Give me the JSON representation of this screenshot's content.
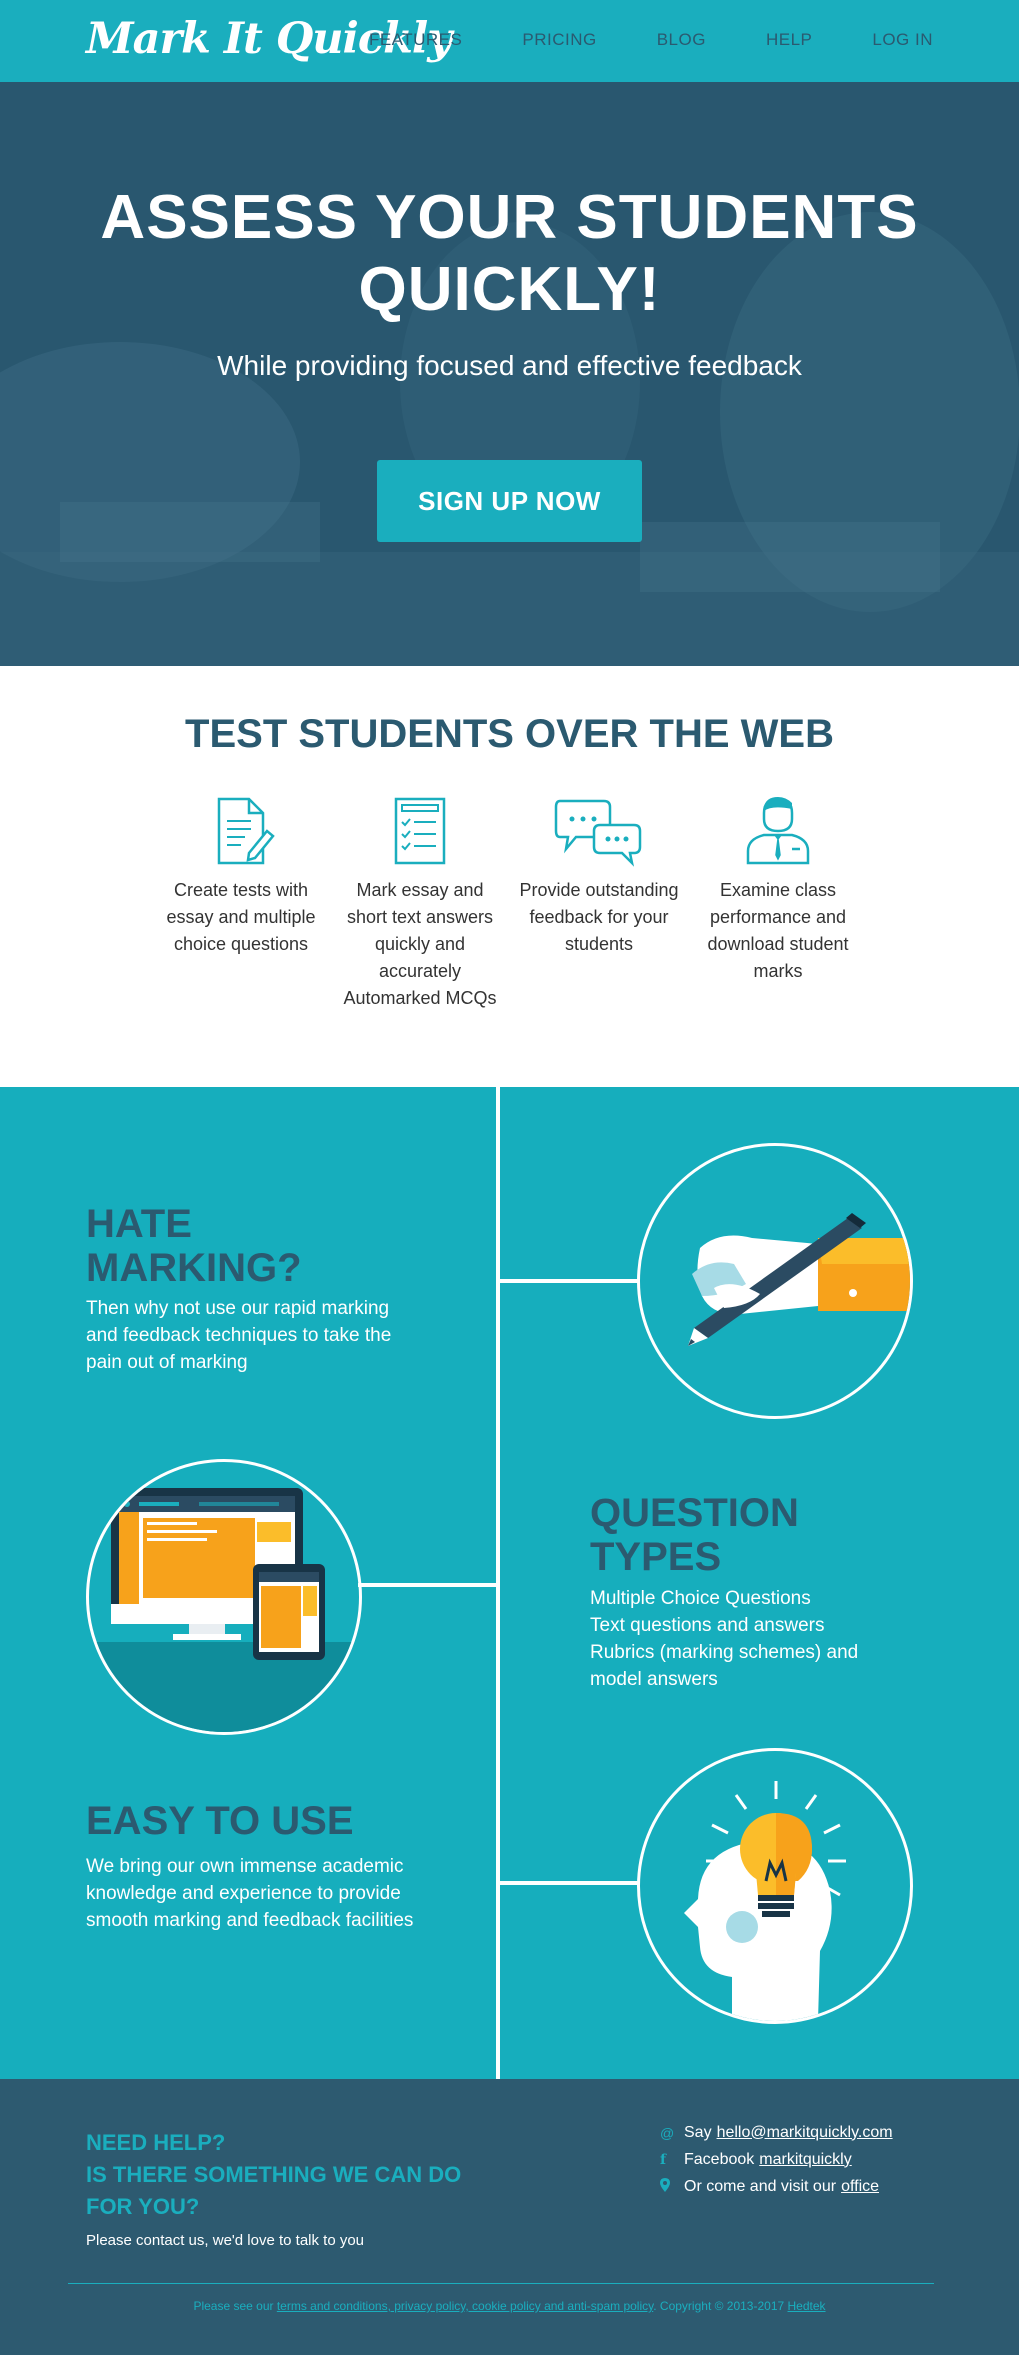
{
  "nav": {
    "logo": "Mark It Quickly",
    "links": [
      "FEATURES",
      "PRICING",
      "BLOG",
      "HELP",
      "LOG IN"
    ]
  },
  "hero": {
    "title_line1": "ASSESS YOUR STUDENTS",
    "title_line2": "QUICKLY!",
    "subtitle": "While providing focused and effective feedback",
    "cta": "SIGN UP NOW"
  },
  "features": {
    "title": "TEST STUDENTS OVER THE WEB",
    "items": [
      {
        "text": "Create tests with essay and multiple choice questions",
        "icon": "document-pencil-icon"
      },
      {
        "text": "Mark essay and short text answers quickly and accurately Automarked MCQs",
        "icon": "checklist-icon"
      },
      {
        "text": "Provide outstanding feedback for your students",
        "icon": "chat-bubbles-icon"
      },
      {
        "text": "Examine class performance and download student marks",
        "icon": "teacher-icon"
      }
    ]
  },
  "blocks": {
    "hate": {
      "title_line1": "HATE",
      "title_line2": "MARKING?",
      "text": "Then why not use our rapid marking and feedback techniques to take the pain out of marking"
    },
    "question": {
      "title_line1": "QUESTION",
      "title_line2": "TYPES",
      "lines": [
        "Multiple Choice Questions",
        "Text questions and answers",
        "Rubrics (marking schemes) and model answers"
      ]
    },
    "easy": {
      "title": "EASY TO USE",
      "lines": [
        "We bring our own immense academic knowledge and experience to provide",
        "smooth marking and feedback facilities"
      ]
    }
  },
  "footer": {
    "help_line1": "NEED HELP?",
    "help_line2": "IS THERE SOMETHING WE CAN DO",
    "help_line3": "FOR YOU?",
    "help_text": "Please contact us, we'd love to talk to you",
    "say_label": "Say",
    "email": "hello@markitquickly.com",
    "facebook_label": "Facebook",
    "facebook_link": "markitquickly",
    "visit_label": "Or come and visit our",
    "visit_link": "office",
    "copyright_prefix": "Please see our",
    "policies_link": "terms and conditions, privacy policy, cookie policy and anti-spam policy",
    "copyright_mid": ". Copyright © 2013-2017",
    "company_link": "Hedtek"
  },
  "colors": {
    "teal": "#1aaebe",
    "navy": "#2b5a70",
    "orange": "#f7a21b"
  }
}
